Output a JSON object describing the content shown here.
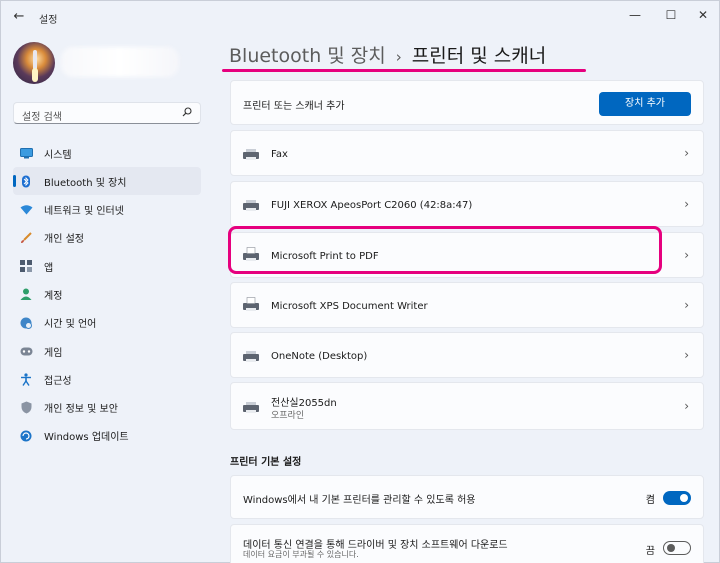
{
  "window": {
    "title": "설정",
    "back_glyph": "←",
    "min_glyph": "—",
    "max_glyph": "☐",
    "close_glyph": "✕"
  },
  "search": {
    "placeholder": "설정 검색",
    "icon": "search-icon"
  },
  "sidebar": {
    "items": [
      {
        "label": "시스템",
        "icon": "monitor-icon",
        "selected": false
      },
      {
        "label": "Bluetooth 및 장치",
        "icon": "bluetooth-icon",
        "selected": true
      },
      {
        "label": "네트워크 및 인터넷",
        "icon": "wifi-icon",
        "selected": false
      },
      {
        "label": "개인 설정",
        "icon": "brush-icon",
        "selected": false
      },
      {
        "label": "앱",
        "icon": "apps-icon",
        "selected": false
      },
      {
        "label": "계정",
        "icon": "person-icon",
        "selected": false
      },
      {
        "label": "시간 및 언어",
        "icon": "globe-clock-icon",
        "selected": false
      },
      {
        "label": "게임",
        "icon": "gamepad-icon",
        "selected": false
      },
      {
        "label": "접근성",
        "icon": "accessibility-icon",
        "selected": false
      },
      {
        "label": "개인 정보 및 보안",
        "icon": "shield-icon",
        "selected": false
      },
      {
        "label": "Windows 업데이트",
        "icon": "update-icon",
        "selected": false
      }
    ]
  },
  "header": {
    "breadcrumb_parent": "Bluetooth 및 장치",
    "separator": "›",
    "title": "프린터 및 스캐너"
  },
  "add_device": {
    "label": "프린터 또는 스캐너 추가",
    "button": "장치 추가"
  },
  "printers": [
    {
      "name": "Fax",
      "status": ""
    },
    {
      "name": "FUJI XEROX ApeosPort C2060 (42:8a:47)",
      "status": ""
    },
    {
      "name": "Microsoft Print to PDF",
      "status": ""
    },
    {
      "name": "Microsoft XPS Document Writer",
      "status": ""
    },
    {
      "name": "OneNote (Desktop)",
      "status": ""
    },
    {
      "name": "전산실2055dn",
      "status": "오프라인"
    }
  ],
  "settings_section": {
    "title": "프린터 기본 설정",
    "default_printer": {
      "label": "Windows에서 내 기본 프린터를 관리할 수 있도록 허용",
      "state": "켬",
      "on": true
    },
    "metered_download": {
      "label": "데이터 통신 연결을 통해 드라이버 및 장치 소프트웨어 다운로드",
      "sub": "데이터 요금이 부과될 수 있습니다.",
      "state": "끔",
      "on": false
    }
  },
  "colors": {
    "accent": "#0067c0",
    "highlight": "#e6007e"
  }
}
